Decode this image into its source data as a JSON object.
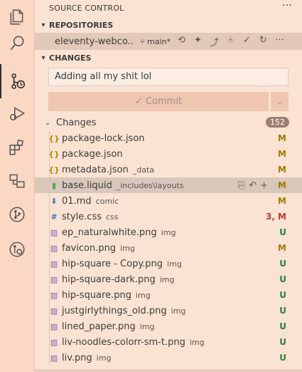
{
  "colors": {
    "activity_bg": "#fad8c4",
    "sidebar_bg": "#fbe3d3",
    "selected_row": "#d9c7bb",
    "modified": "#a07a00",
    "untracked": "#2e7d32",
    "conflict": "#c0392b",
    "badge_bg": "#a07e73"
  },
  "activity_bar": [
    {
      "name": "explorer",
      "icon": "files-icon"
    },
    {
      "name": "search",
      "icon": "search-icon"
    },
    {
      "name": "source-control",
      "icon": "source-control-icon",
      "active": true
    },
    {
      "name": "run-debug",
      "icon": "run-debug-icon"
    },
    {
      "name": "extensions",
      "icon": "extensions-icon"
    },
    {
      "name": "remote-explorer",
      "icon": "remote-icon"
    },
    {
      "name": "git-graph",
      "icon": "git-graph-icon"
    },
    {
      "name": "pull-requests",
      "icon": "pull-request-icon"
    }
  ],
  "header": {
    "title": "SOURCE CONTROL",
    "more": "···"
  },
  "repositories": {
    "section_title": "REPOSITORIES",
    "repo_name": "eleventy-webco...",
    "branch": "main*",
    "more": "···"
  },
  "changes_section": {
    "section_title": "CHANGES",
    "commit_message": "Adding all my shit lol",
    "commit_label": "✓ Commit",
    "changes_label": "Changes",
    "count": "152"
  },
  "files": [
    {
      "icon": "{}",
      "icon_color": "#b58900",
      "name": "package-lock.json",
      "dir": "",
      "status": "M",
      "status_color": "#a07a00"
    },
    {
      "icon": "{}",
      "icon_color": "#b58900",
      "name": "package.json",
      "dir": "",
      "status": "M",
      "status_color": "#a07a00"
    },
    {
      "icon": "{}",
      "icon_color": "#b58900",
      "name": "metadata.json",
      "dir": "_data",
      "status": "M",
      "status_color": "#a07a00"
    },
    {
      "icon": "▮",
      "icon_color": "#4caf50",
      "name": "base.liquid",
      "dir": "_includes\\layouts",
      "status": "M",
      "status_color": "#a07a00",
      "selected": true
    },
    {
      "icon": "⬇",
      "icon_color": "#3a7bd5",
      "name": "01.md",
      "dir": "comic",
      "status": "M",
      "status_color": "#a07a00"
    },
    {
      "icon": "#",
      "icon_color": "#3a7bd5",
      "name": "style.css",
      "dir": "css",
      "status": "3, M",
      "status_color": "#c0392b"
    },
    {
      "icon": "▨",
      "icon_color": "#8e5fb5",
      "name": "ep_naturalwhite.png",
      "dir": "img",
      "status": "U",
      "status_color": "#2e7d32"
    },
    {
      "icon": "▨",
      "icon_color": "#8e5fb5",
      "name": "favicon.png",
      "dir": "img",
      "status": "M",
      "status_color": "#a07a00"
    },
    {
      "icon": "▨",
      "icon_color": "#8e5fb5",
      "name": "hip-square - Copy.png",
      "dir": "img",
      "status": "U",
      "status_color": "#2e7d32"
    },
    {
      "icon": "▨",
      "icon_color": "#8e5fb5",
      "name": "hip-square-dark.png",
      "dir": "img",
      "status": "U",
      "status_color": "#2e7d32"
    },
    {
      "icon": "▨",
      "icon_color": "#8e5fb5",
      "name": "hip-square.png",
      "dir": "img",
      "status": "U",
      "status_color": "#2e7d32"
    },
    {
      "icon": "▨",
      "icon_color": "#8e5fb5",
      "name": "justgirlythings_old.png",
      "dir": "img",
      "status": "U",
      "status_color": "#2e7d32"
    },
    {
      "icon": "▨",
      "icon_color": "#8e5fb5",
      "name": "lined_paper.png",
      "dir": "img",
      "status": "U",
      "status_color": "#2e7d32"
    },
    {
      "icon": "▨",
      "icon_color": "#8e5fb5",
      "name": "liv-noodles-colorr-sm-t.png",
      "dir": "img",
      "status": "U",
      "status_color": "#2e7d32"
    },
    {
      "icon": "▨",
      "icon_color": "#8e5fb5",
      "name": "liv.png",
      "dir": "img",
      "status": "U",
      "status_color": "#2e7d32"
    }
  ]
}
